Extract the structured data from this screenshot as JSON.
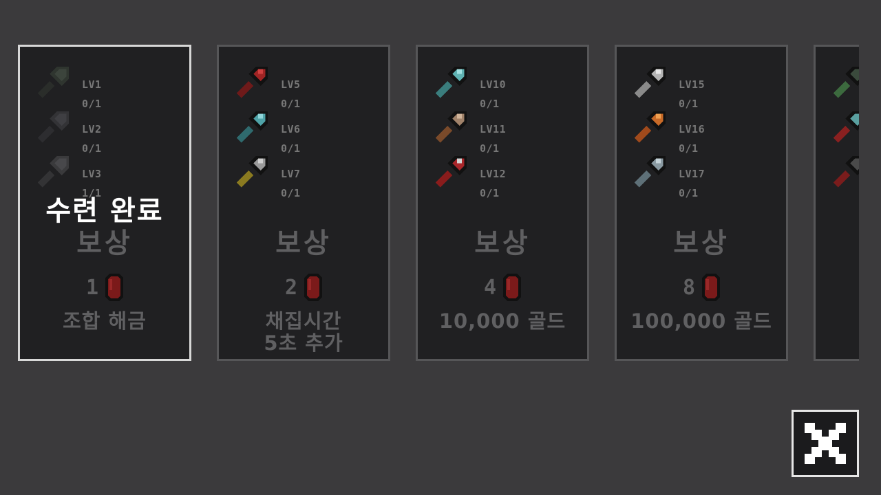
{
  "colors": {
    "background": "#3b3a3c",
    "card": "#202022",
    "card_border": "#565658",
    "selected_border": "#d8d8d8",
    "gem": "#8e1b1b"
  },
  "cards": [
    {
      "selected": true,
      "status": "수련 완료",
      "reward_title": "보상",
      "reward_amount": "1",
      "reward_icon": "red-gem-icon",
      "reward_text": "조합 해금",
      "requirements": [
        {
          "level": "LV1",
          "count": "0/1",
          "icon": "dark-green-shovel-icon"
        },
        {
          "level": "LV2",
          "count": "0/1",
          "icon": "dark-gray-shovel-icon"
        },
        {
          "level": "LV3",
          "count": "1/1",
          "icon": "stone-shovel-icon"
        }
      ]
    },
    {
      "selected": false,
      "reward_title": "보상",
      "reward_amount": "2",
      "reward_icon": "red-gem-icon",
      "reward_text": "채집시간\n5초 추가",
      "requirements": [
        {
          "level": "LV5",
          "count": "0/1",
          "icon": "red-shovel-icon"
        },
        {
          "level": "LV6",
          "count": "0/1",
          "icon": "cyan-shovel-icon"
        },
        {
          "level": "LV7",
          "count": "0/1",
          "icon": "gold-handle-shovel-icon"
        }
      ]
    },
    {
      "selected": false,
      "reward_title": "보상",
      "reward_amount": "4",
      "reward_icon": "red-gem-icon",
      "reward_text": "10,000 골드",
      "requirements": [
        {
          "level": "LV10",
          "count": "0/1",
          "icon": "teal-shovel-icon"
        },
        {
          "level": "LV11",
          "count": "0/1",
          "icon": "bronze-shovel-icon"
        },
        {
          "level": "LV12",
          "count": "0/1",
          "icon": "crimson-shovel-icon"
        }
      ]
    },
    {
      "selected": false,
      "reward_title": "보상",
      "reward_amount": "8",
      "reward_icon": "red-gem-icon",
      "reward_text": "100,000 골드",
      "requirements": [
        {
          "level": "LV15",
          "count": "0/1",
          "icon": "silver-shovel-icon"
        },
        {
          "level": "LV16",
          "count": "0/1",
          "icon": "orange-shovel-icon"
        },
        {
          "level": "LV17",
          "count": "0/1",
          "icon": "steel-blue-shovel-icon"
        }
      ]
    },
    {
      "selected": false,
      "partial": true,
      "requirements": [
        {
          "icon": "green-shovel-icon"
        },
        {
          "icon": "teal-red-shovel-icon"
        },
        {
          "icon": "dark-red-shovel-icon"
        }
      ]
    }
  ],
  "close_button": {
    "icon": "close-icon"
  }
}
